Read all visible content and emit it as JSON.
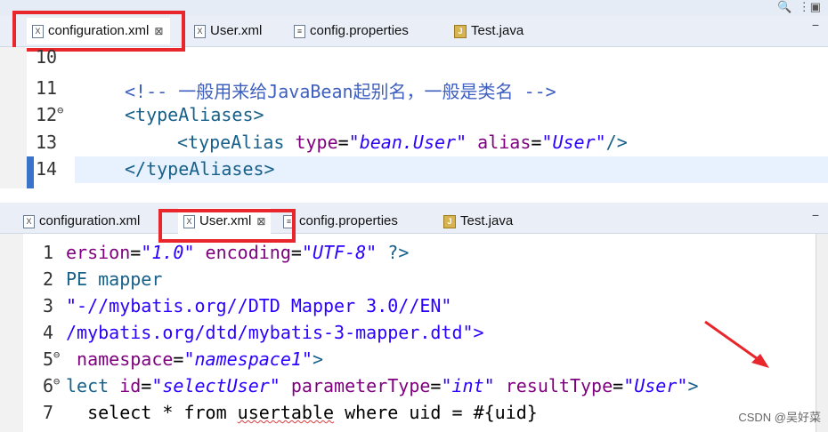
{
  "top_editor": {
    "tabs": [
      {
        "label": "configuration.xml",
        "close": "⊠"
      },
      {
        "label": "User.xml"
      },
      {
        "label": "config.properties"
      },
      {
        "label": "Test.java"
      }
    ],
    "lines": [
      {
        "num": "10",
        "text": ""
      },
      {
        "num": "11",
        "comment": "<!-- 一般用来给JavaBean起别名，一般是类名 -->"
      },
      {
        "num": "12",
        "fold": "⊖",
        "tag": "<typeAliases>"
      },
      {
        "num": "13",
        "tag_open": "<typeAlias ",
        "attr1": "type",
        "eq1": "=",
        "val1": "\"bean.User\"",
        "attr2": " alias",
        "eq2": "=",
        "val2": "\"User\"",
        "tag_close": "/>"
      },
      {
        "num": "14",
        "tag": "</typeAliases>"
      }
    ]
  },
  "bottom_editor": {
    "tabs": [
      {
        "label": "configuration.xml"
      },
      {
        "label": "User.xml",
        "close": "⊠"
      },
      {
        "label": "config.properties"
      },
      {
        "label": "Test.java"
      }
    ],
    "lines": [
      {
        "num": "1",
        "p1": "ersion",
        "eq": "=",
        "v1": "\"1.0\"",
        "p2": " encoding",
        "v2": "\"UTF-8\"",
        "tail": " ?>"
      },
      {
        "num": "2",
        "text": "PE mapper"
      },
      {
        "num": "3",
        "text": "\"-//mybatis.org//DTD Mapper 3.0//EN\""
      },
      {
        "num": "4",
        "text": "/mybatis.org/dtd/mybatis-3-mapper.dtd\">"
      },
      {
        "num": "5",
        "fold": "⊖",
        "a1": " namespace",
        "v1": "\"namespace1\"",
        "tail": ">"
      },
      {
        "num": "6",
        "fold": "⊖",
        "p0": "lect",
        "a1": " id",
        "v1": "\"selectUser\"",
        "a2": " parameterType",
        "v2": "\"int\"",
        "a3": " resultType",
        "v3": "\"User\"",
        "tail": ">"
      },
      {
        "num": "7",
        "sql1": "  select * from ",
        "sql2": "usertable",
        "sql3": " where uid = #{uid}"
      }
    ]
  },
  "watermark": "CSDN @吴好菜",
  "colors": {
    "highlight": "#e8262b",
    "arrow": "#e8262b"
  }
}
